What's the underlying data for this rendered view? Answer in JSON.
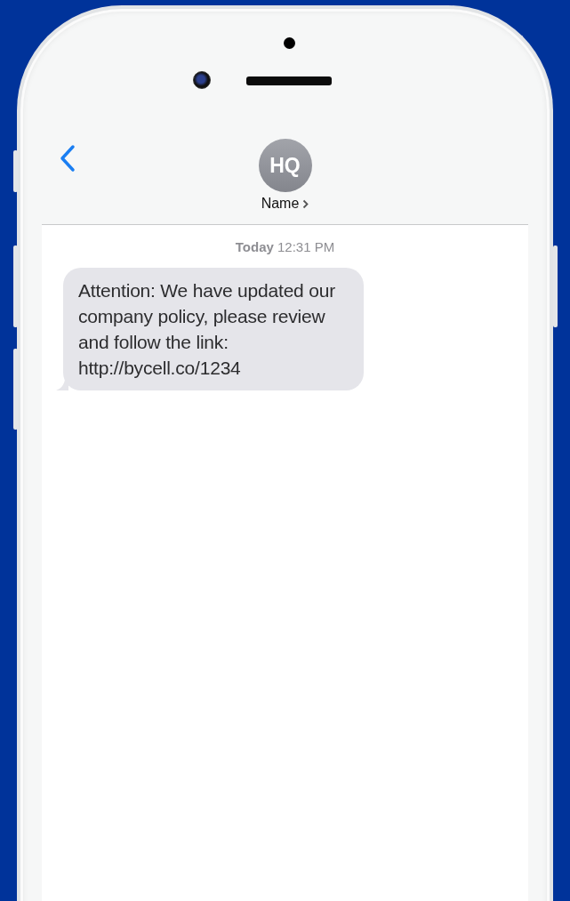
{
  "header": {
    "avatar_initials": "HQ",
    "contact_name": "Name"
  },
  "thread": {
    "timestamp": "**Today** 12:31 PM",
    "messages": [
      {
        "kind": "received",
        "text": "Attention: We have updated our company policy, please review and follow the link: http://bycell.co/1234"
      }
    ]
  }
}
